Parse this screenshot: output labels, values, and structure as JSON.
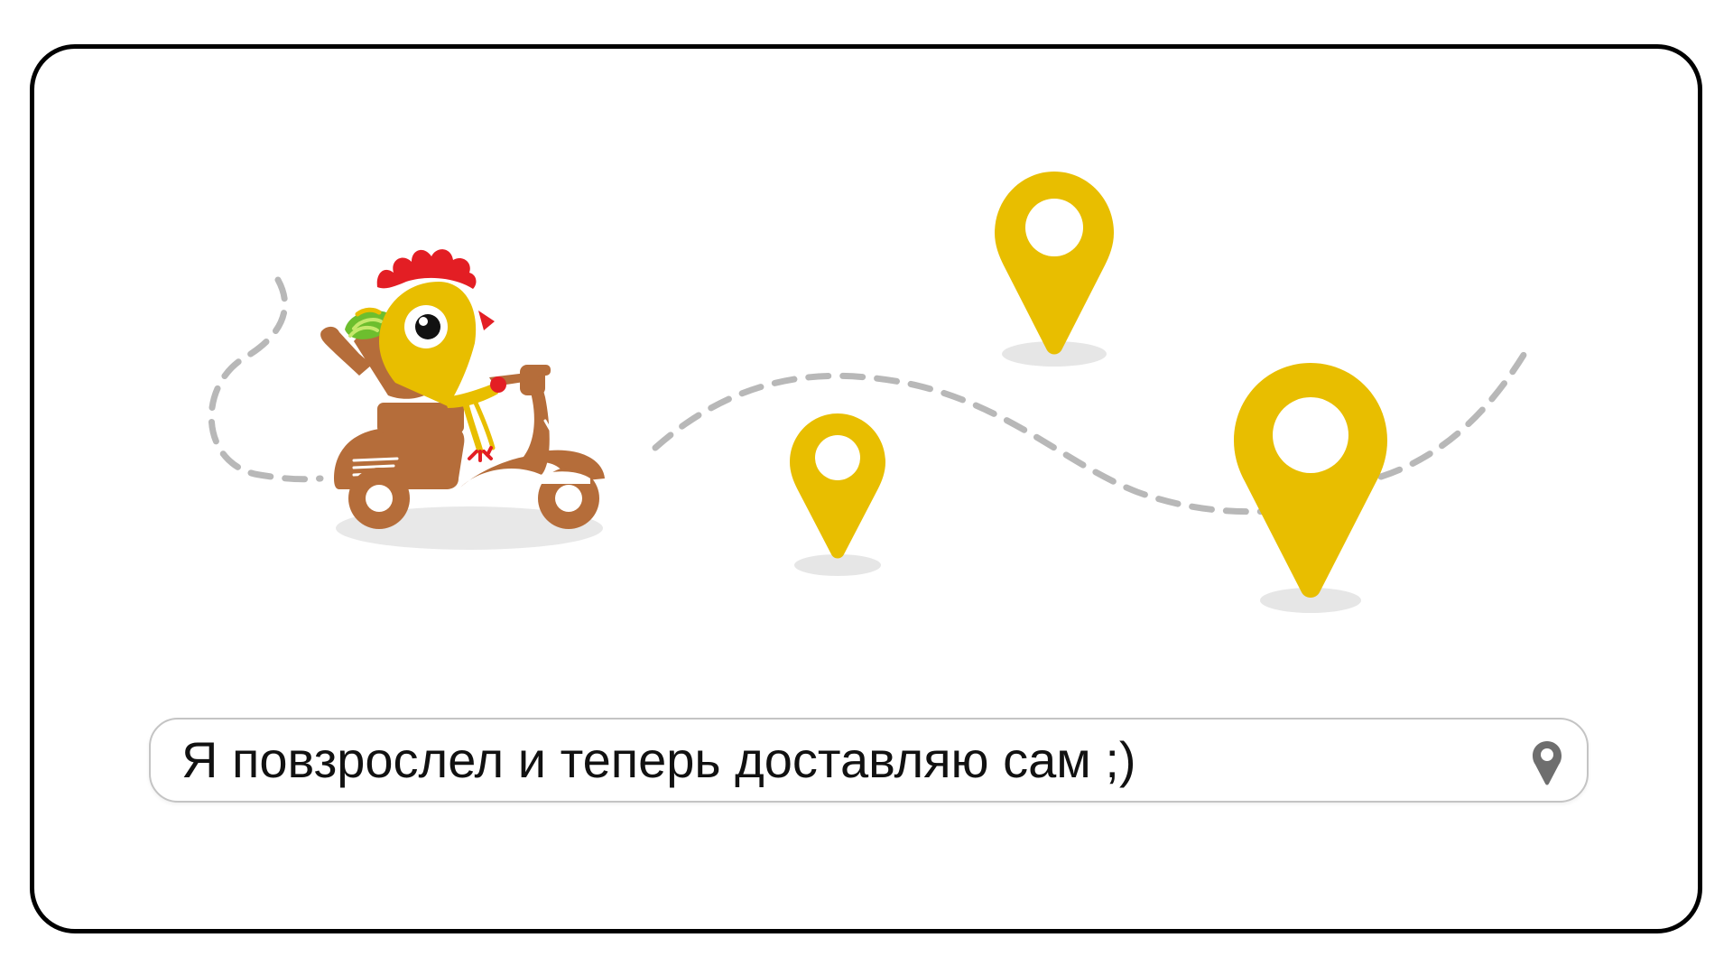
{
  "search": {
    "text": "Я повзрослел и теперь доставляю сам ;)",
    "icon": "location-pin-icon"
  },
  "illustration": {
    "character": "rooster-courier-on-scooter",
    "pins": [
      "location-pin-icon",
      "location-pin-icon",
      "location-pin-icon"
    ]
  },
  "colors": {
    "pin": "#E8BE00",
    "scooter": "#B56D3A",
    "comb": "#E31E24",
    "route": "#B8B8B8",
    "frame": "#000000"
  }
}
